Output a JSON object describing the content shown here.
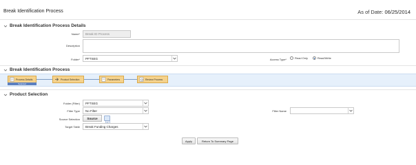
{
  "header": {
    "title": "Break Identification Process",
    "as_of_label": "As of Date:",
    "as_of_value": "06/25/2014"
  },
  "details": {
    "section_title": "Break Identification Process Details",
    "name_label": "Name*",
    "name_value": "Break ID Process",
    "description_label": "Description",
    "description_value": "",
    "folder_label": "Folder*",
    "folder_value": "PFTSEG",
    "access_label": "Access Type*",
    "access_options": [
      "Read Only",
      "Read/Write"
    ],
    "access_selected": "Read/Write"
  },
  "process": {
    "section_title": "Break Identification Process",
    "steps": [
      "Process Details",
      "Product Selection",
      "Parameters",
      "Review Process"
    ],
    "current_step_note": "Selected"
  },
  "product": {
    "section_title": "Product Selection",
    "folder_filter_label": "Folder (Filter)",
    "folder_filter_value": "PFTSEG",
    "filter_type_label": "Filter Type",
    "filter_type_value": "No Filter",
    "filter_name_label": "Filter Name",
    "filter_name_value": "",
    "source_selection_label": "Source Selection",
    "source_button": "Source",
    "target_table_label": "Target Table",
    "target_table_value": "Break Funding Charges"
  },
  "actions": {
    "apply": "Apply",
    "return": "Return To Summary Page"
  }
}
